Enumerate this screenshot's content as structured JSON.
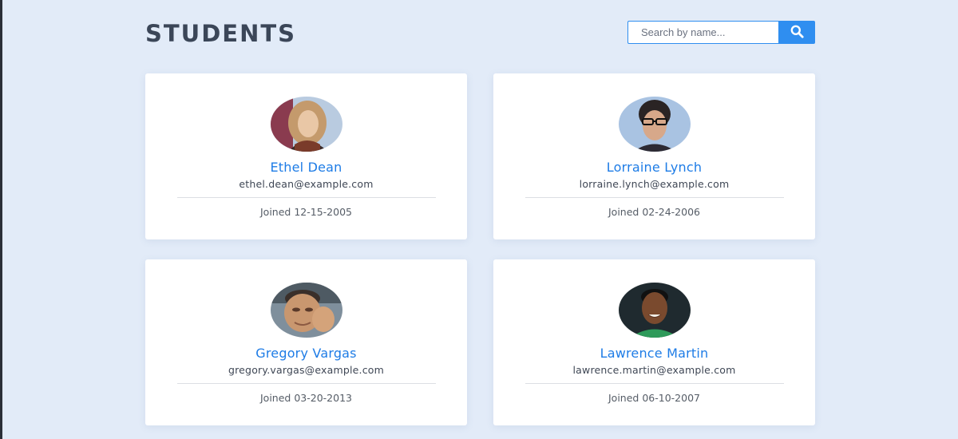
{
  "header": {
    "title": "STUDENTS"
  },
  "search": {
    "placeholder": "Search by name...",
    "icon": "search-icon"
  },
  "colors": {
    "background": "#e2ebf8",
    "accent": "#2f8ef0",
    "name": "#1e7ce6",
    "title": "#3b4658"
  },
  "students": [
    {
      "name": "Ethel Dean",
      "email": "ethel.dean@example.com",
      "joined": "Joined 12-15-2005"
    },
    {
      "name": "Lorraine Lynch",
      "email": "lorraine.lynch@example.com",
      "joined": "Joined 02-24-2006"
    },
    {
      "name": "Gregory Vargas",
      "email": "gregory.vargas@example.com",
      "joined": "Joined 03-20-2013"
    },
    {
      "name": "Lawrence Martin",
      "email": "lawrence.martin@example.com",
      "joined": "Joined 06-10-2007"
    }
  ]
}
